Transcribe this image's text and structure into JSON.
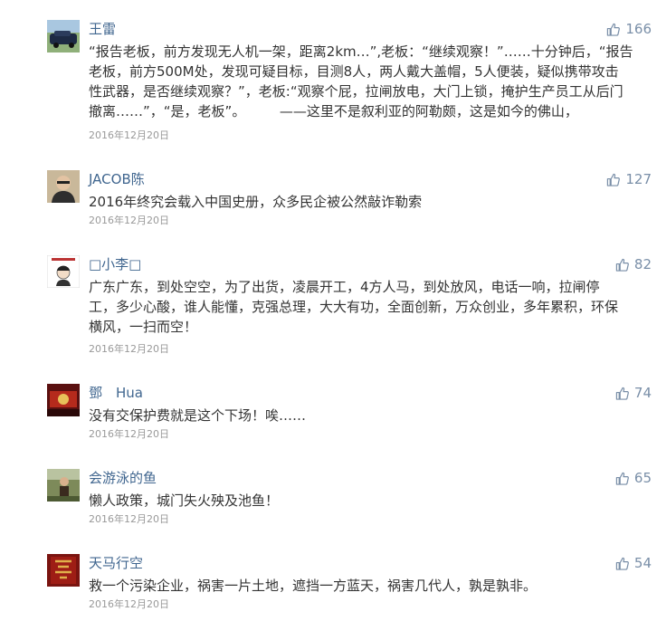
{
  "comments": [
    {
      "user": "王雷",
      "likes": "166",
      "text": [
        "“报告老板，前方发现无人机一架，距离2km…”,老板：“继续观察！”……十分钟后，“报告",
        "老板，前方500M处，发现可疑目标，目测8人，两人戴大盖帽，5人便装，疑似携带攻击",
        "性武器，是否继续观察？”，老板:“观察个屁，拉闸放电，大门上锁，掩护生产员工从后门",
        "撤离……”，“是，老板”。　　　——这里不是叙利亚的阿勒颇，这是如今的佛山，"
      ],
      "date": "2016年12月20日"
    },
    {
      "user": "JACOB陈",
      "likes": "127",
      "text": [
        "2016年终究会载入中国史册，众多民企被公然敲诈勒索"
      ],
      "date": "2016年12月20日"
    },
    {
      "user": "□小李□",
      "likes": "82",
      "text": [
        "广东广东，到处空空，为了出货，凌晨开工，4方人马，到处放风，电话一响，拉闸停",
        "工，多少心酸，谁人能懂，克强总理，大大有功，全面创新，万众创业，多年累积，环保",
        "横风，一扫而空！"
      ],
      "date": "2016年12月20日"
    },
    {
      "user": "鄧　Hua",
      "likes": "74",
      "text": [
        "没有交保护费就是这个下场！唉……"
      ],
      "date": "2016年12月20日"
    },
    {
      "user": "会游泳的鱼",
      "likes": "65",
      "text": [
        "懒人政策，城门失火殃及池鱼！"
      ],
      "date": "2016年12月20日"
    },
    {
      "user": "天马行空",
      "likes": "54",
      "text": [
        "救一个污染企业，祸害一片土地，遮挡一方蓝天，祸害几代人，孰是孰非。"
      ],
      "date": "2016年12月20日"
    }
  ],
  "icons": {
    "like": "thumbs-up-icon"
  },
  "colors": {
    "username": "#40668f",
    "like": "#7a8fa8",
    "text": "#333333",
    "date": "#999999"
  }
}
